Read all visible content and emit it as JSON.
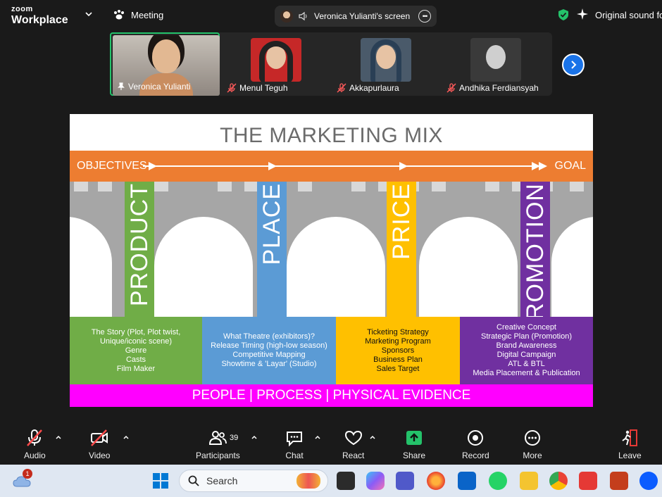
{
  "app": {
    "brand_top": "zoom",
    "brand_bottom": "Workplace",
    "meeting_label": "Meeting"
  },
  "screen_share": {
    "label": "Veronica Yulianti's screen",
    "more": "•••"
  },
  "status": {
    "original_sound": "Original sound for"
  },
  "participants": [
    {
      "name": "Veronica Yulianti"
    },
    {
      "name": "Menul Teguh"
    },
    {
      "name": "Akkapurlaura"
    },
    {
      "name": "Andhika Ferdiansyah"
    }
  ],
  "slide": {
    "title": "THE MARKETING MIX",
    "objectives": "OBJECTIVES",
    "goal": "GOAL",
    "pillars": [
      {
        "label": "PRODUCT",
        "color": "#70ad47"
      },
      {
        "label": "PLACE",
        "color": "#5b9bd5"
      },
      {
        "label": "PRICE",
        "color": "#ffc000"
      },
      {
        "label": "PROMOTION",
        "color": "#7030a0"
      }
    ],
    "boxes": [
      {
        "lines": [
          "The Story (Plot, Plot twist,",
          "Unique/iconic scene)",
          "Genre",
          "Casts",
          "Film Maker"
        ],
        "color": "#70ad47"
      },
      {
        "lines": [
          "What Theatre (exhibitors)?",
          "Release Timing (high-low season)",
          "Competitive Mapping",
          "Showtime & 'Layar' (Studio)"
        ],
        "color": "#5b9bd5"
      },
      {
        "lines": [
          "Ticketing Strategy",
          "Marketing Program",
          "Sponsors",
          "Business Plan",
          "Sales Target"
        ],
        "color": "#ffc000"
      },
      {
        "lines": [
          "Creative Concept",
          "Strategic Plan (Promotion)",
          "Brand Awareness",
          "Digital Campaign",
          "ATL & BTL",
          "Media Placement & Publication"
        ],
        "color": "#7030a0"
      }
    ],
    "footer": "PEOPLE | PROCESS | PHYSICAL EVIDENCE"
  },
  "toolbar": {
    "audio": "Audio",
    "video": "Video",
    "participants": "Participants",
    "participants_count": "39",
    "chat": "Chat",
    "react": "React",
    "share": "Share",
    "record": "Record",
    "more": "More",
    "leave": "Leave"
  },
  "taskbar": {
    "search_placeholder": "Search",
    "weather_badge": "1"
  }
}
